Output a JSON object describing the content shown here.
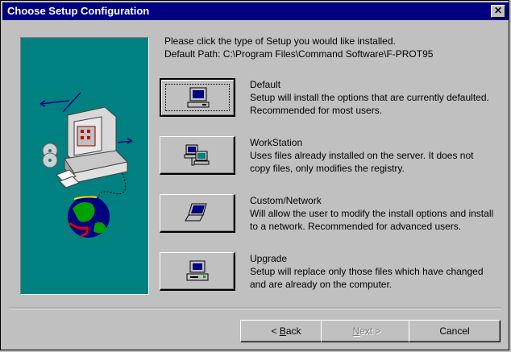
{
  "window": {
    "title": "Choose Setup Configuration",
    "close_glyph": "✕"
  },
  "intro": {
    "line1": "Please click the type of Setup you would like installed.",
    "line2": "Default Path: C:\\Program Files\\Command Software\\F-PROT95"
  },
  "options": [
    {
      "label": "Default",
      "icon": "desktop-computer-icon",
      "description": "Setup will install the options that are currently defaulted. Recommended for most users."
    },
    {
      "label": "WorkStation",
      "icon": "network-workstation-icon",
      "description": "Uses files already installed on the server. It does not copy files, only modifies the registry."
    },
    {
      "label": "Custom/Network",
      "icon": "laptop-icon",
      "description": "Will allow the user to modify the install options and install to a network. Recommended for advanced users."
    },
    {
      "label": "Upgrade",
      "icon": "upgrade-computer-icon",
      "description": "Setup will replace only those files which have changed and are already on the computer."
    }
  ],
  "buttons": {
    "back": {
      "prefix": "< ",
      "accel": "B",
      "rest": "ack"
    },
    "next": {
      "accel": "N",
      "rest": "ext >"
    },
    "cancel": "Cancel"
  }
}
